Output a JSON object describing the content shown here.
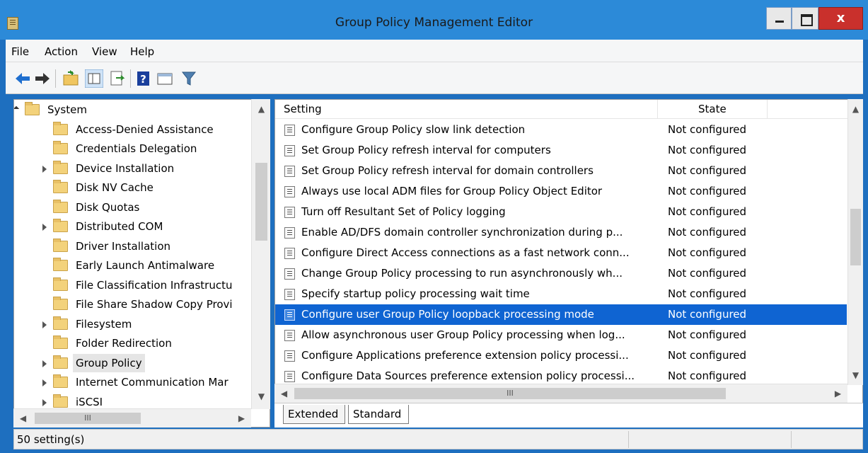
{
  "window": {
    "title": "Group Policy Management Editor",
    "close_glyph": "x"
  },
  "menu": [
    "File",
    "Action",
    "View",
    "Help"
  ],
  "toolbar": {
    "buttons": [
      "back-icon",
      "forward-icon",
      "up-folder-icon",
      "show-hide-tree-icon",
      "export-list-icon",
      "help-icon",
      "properties-icon",
      "filter-icon"
    ]
  },
  "tree": {
    "items": [
      {
        "label": "System",
        "expanded": true
      },
      {
        "label": "Access-Denied Assistance"
      },
      {
        "label": "Credentials Delegation"
      },
      {
        "label": "Device Installation",
        "expandable": true
      },
      {
        "label": "Disk NV Cache"
      },
      {
        "label": "Disk Quotas"
      },
      {
        "label": "Distributed COM",
        "expandable": true
      },
      {
        "label": "Driver Installation"
      },
      {
        "label": "Early Launch Antimalware"
      },
      {
        "label": "File Classification Infrastructu"
      },
      {
        "label": "File Share Shadow Copy Provi"
      },
      {
        "label": "Filesystem",
        "expandable": true
      },
      {
        "label": "Folder Redirection"
      },
      {
        "label": "Group Policy",
        "expandable": true,
        "highlighted": true
      },
      {
        "label": "Internet Communication Mar",
        "expandable": true
      },
      {
        "label": "iSCSI",
        "expandable": true
      }
    ],
    "hscroll_thumb_glyph": "III"
  },
  "list": {
    "columns": {
      "setting": "Setting",
      "state": "State"
    },
    "rows": [
      {
        "setting": "Configure Group Policy slow link detection",
        "state": "Not configured"
      },
      {
        "setting": "Set Group Policy refresh interval for computers",
        "state": "Not configured"
      },
      {
        "setting": "Set Group Policy refresh interval for domain controllers",
        "state": "Not configured"
      },
      {
        "setting": "Always use local ADM files for Group Policy Object Editor",
        "state": "Not configured"
      },
      {
        "setting": "Turn off Resultant Set of Policy logging",
        "state": "Not configured"
      },
      {
        "setting": "Enable AD/DFS domain controller synchronization during p...",
        "state": "Not configured"
      },
      {
        "setting": "Configure Direct Access connections as a fast network conn...",
        "state": "Not configured"
      },
      {
        "setting": "Change Group Policy processing to run asynchronously wh...",
        "state": "Not configured"
      },
      {
        "setting": "Specify startup policy processing wait time",
        "state": "Not configured"
      },
      {
        "setting": "Configure user Group Policy loopback processing mode",
        "state": "Not configured",
        "selected": true
      },
      {
        "setting": "Allow asynchronous user Group Policy processing when log...",
        "state": "Not configured"
      },
      {
        "setting": "Configure Applications preference extension policy processi...",
        "state": "Not configured"
      },
      {
        "setting": "Configure Data Sources preference extension policy processi...",
        "state": "Not configured"
      }
    ],
    "hscroll_thumb_glyph": "III"
  },
  "tabs": [
    "Extended",
    "Standard"
  ],
  "status": {
    "text": "50 setting(s)"
  },
  "colors": {
    "selection": "#0f64d2",
    "titlebar": "#2c8ad8",
    "close": "#c9302c"
  }
}
